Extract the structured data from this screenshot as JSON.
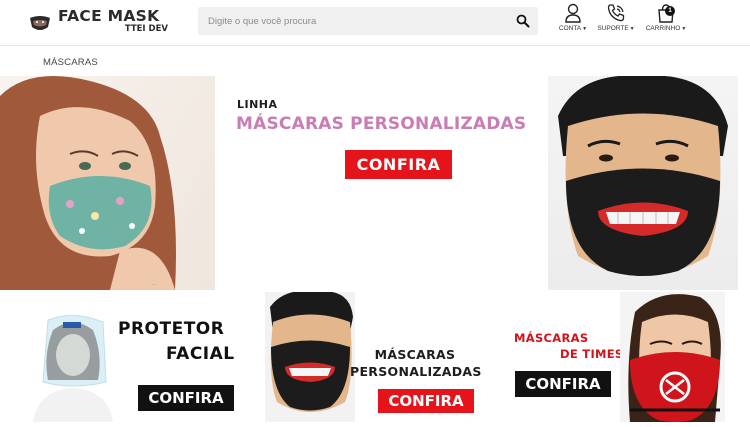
{
  "brand": {
    "title": "FACE MASK",
    "subtitle": "TTEI DEV"
  },
  "search": {
    "placeholder": "Digite o que você procura",
    "icon": "search-icon"
  },
  "nav": {
    "account": {
      "label": "CONTA",
      "icon": "user-icon"
    },
    "support": {
      "label": "SUPORTE",
      "icon": "phone-icon"
    },
    "cart": {
      "label": "CARRINHO",
      "icon": "shopping-bag-icon",
      "count": "1"
    }
  },
  "breadcrumb": "MÁSCARAS",
  "hero": {
    "kicker": "LINHA",
    "title": "MÁSCARAS PERSONALIZADAS",
    "cta": "CONFIRA",
    "credit": "..."
  },
  "promos": [
    {
      "title_line1": "PROTETOR",
      "title_line2": "FACIAL",
      "cta": "CONFIRA"
    },
    {
      "title_line1": "MÁSCARAS",
      "title_line2": "PERSONALIZADAS",
      "cta": "CONFIRA"
    },
    {
      "title_line1": "MÁSCARAS",
      "title_line2": "DE TIMES",
      "cta": "CONFIRA"
    }
  ],
  "colors": {
    "accent_red": "#e5141b",
    "pink": "#c97db2",
    "dark": "#111111"
  }
}
